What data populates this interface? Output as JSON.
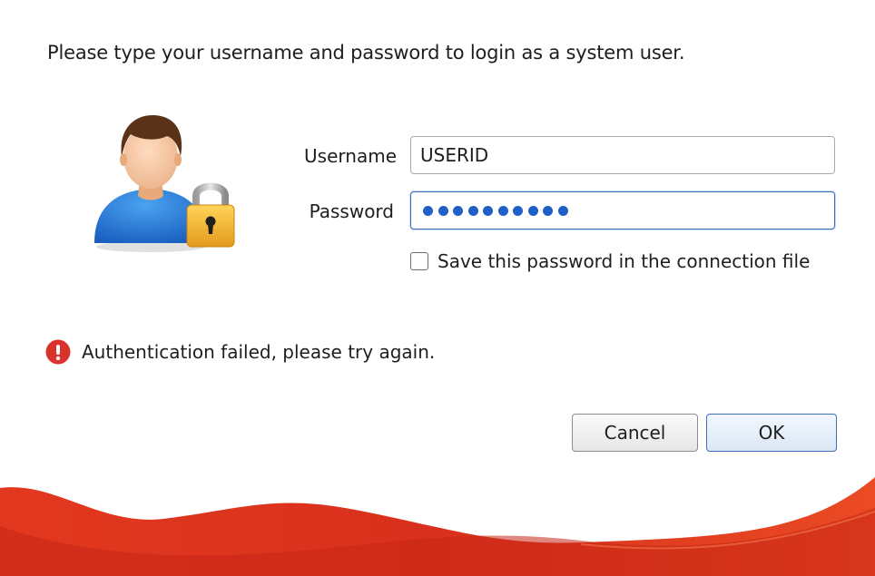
{
  "dialog": {
    "prompt": "Please type your username and password to login as a system user."
  },
  "form": {
    "username_label": "Username",
    "username_value": "USERID",
    "password_label": "Password",
    "password_mask_count": 10,
    "save_password_label": "Save this password in the connection file",
    "save_password_checked": false
  },
  "status": {
    "error_message": "Authentication failed, please try again."
  },
  "buttons": {
    "cancel_label": "Cancel",
    "ok_label": "OK"
  },
  "icons": {
    "avatar": "user-lock-icon",
    "error": "error-exclamation-icon",
    "checkbox": "checkbox-unchecked-icon"
  },
  "colors": {
    "accent": "#1f5fc8",
    "error": "#d9322b",
    "wave": "#e0341f",
    "lock": "#f2b531"
  }
}
